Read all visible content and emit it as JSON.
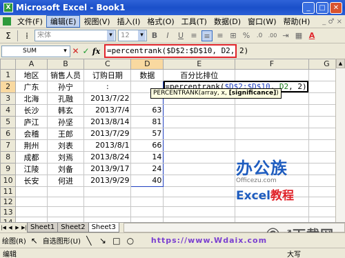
{
  "window": {
    "title": "Microsoft Excel - Book1",
    "app_icon": "X"
  },
  "menu": {
    "items": [
      "文件(F)",
      "编辑(E)",
      "视图(V)",
      "插入(I)",
      "格式(O)",
      "工具(T)",
      "数据(D)",
      "窗口(W)",
      "帮助(H)"
    ],
    "active_index": 1,
    "help_controls": "_ ♂ ×"
  },
  "toolbar": {
    "sigma": "Σ",
    "font_name": "宋体",
    "font_size": "12",
    "bold": "B",
    "italic": "I",
    "underline": "U",
    "percent": "%",
    "decimal_inc": ".0",
    "decimal_dec": ".00",
    "fill_label": "A"
  },
  "formula_bar": {
    "name_box": "SUM",
    "cancel": "✕",
    "enter": "✓",
    "fx": "fx",
    "formula": "=percentrank($D$2:$D$10, D2, 2)"
  },
  "columns": [
    "A",
    "B",
    "C",
    "D",
    "E",
    "F",
    "G"
  ],
  "rows": [
    "1",
    "2",
    "3",
    "4",
    "5",
    "6",
    "7",
    "8",
    "9",
    "10",
    "11",
    "12",
    "13",
    "14",
    "15",
    "16"
  ],
  "table": {
    "headers": [
      "地区",
      "销售人员",
      "订购日期",
      "数据",
      "百分比排位"
    ],
    "data": [
      [
        "广东",
        "孙宁",
        ":",
        "",
        ""
      ],
      [
        "北海",
        "孔融",
        "2013/7/22",
        "",
        ""
      ],
      [
        "长沙",
        "韩玄",
        "2013/7/4",
        "63",
        ""
      ],
      [
        "庐江",
        "孙坚",
        "2013/8/14",
        "81",
        ""
      ],
      [
        "会稽",
        "王郎",
        "2013/7/29",
        "57",
        ""
      ],
      [
        "荆州",
        "刘表",
        "2013/8/1",
        "66",
        ""
      ],
      [
        "成都",
        "刘焉",
        "2013/8/24",
        "14",
        ""
      ],
      [
        "江陵",
        "刘备",
        "2013/9/17",
        "24",
        ""
      ],
      [
        "长安",
        "何进",
        "2013/9/29",
        "40",
        ""
      ]
    ]
  },
  "editing": {
    "prefix": "=percentrank(",
    "ref1": "$D$2:$D$10",
    "sep1": ", ",
    "ref2": "D2",
    "suffix": ", 2)"
  },
  "tooltip": {
    "text": "PERCENTRANK(array, x, ",
    "bold": "[significance]",
    "end": ")"
  },
  "watermark": {
    "logo": "办公族",
    "url": "Officezu.com",
    "brand_en": "Excel",
    "brand_cn": "教程",
    "site": "Ⓒ♂下载网"
  },
  "sheets": [
    "Sheet1",
    "Sheet2",
    "Sheet3"
  ],
  "active_sheet": 2,
  "drawbar": {
    "draw": "绘图(R)",
    "autoshapes": "自选图形(U)",
    "url": "https://www.Wdaix.com"
  },
  "status": {
    "left": "编辑",
    "right": "大写"
  },
  "colors": {
    "accent": "#316ac5",
    "formula_highlight": "#e0242b",
    "range_ref": "#1f3fbf"
  }
}
